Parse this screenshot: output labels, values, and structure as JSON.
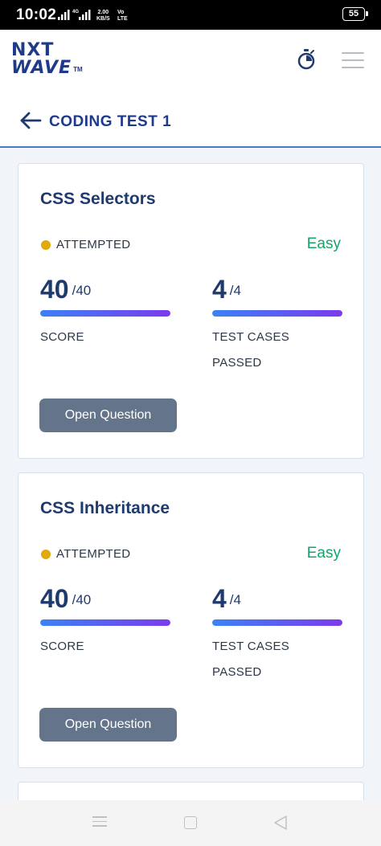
{
  "status_bar": {
    "time": "10:02",
    "network": "4G",
    "speed_value": "2.00",
    "speed_unit": "KB/S",
    "volte_top": "Vo",
    "volte_bottom": "LTE",
    "battery": "55"
  },
  "header": {
    "logo_line1": "NXT",
    "logo_line2": "WAVE",
    "logo_tm": "TM",
    "icons": [
      "stopwatch-icon",
      "hamburger-menu-icon"
    ]
  },
  "subheader": {
    "back_icon": "arrow-left-icon",
    "title": "CODING TEST 1"
  },
  "questions": [
    {
      "title": "CSS Selectors",
      "status": "ATTEMPTED",
      "status_color": "#e0a90c",
      "difficulty": "Easy",
      "difficulty_color": "#16a36b",
      "score": {
        "value": "40",
        "total": "/40",
        "label": "SCORE",
        "progress": 1.0
      },
      "test_cases": {
        "value": "4",
        "total": "/4",
        "label_line1": "TEST CASES",
        "label_line2": "PASSED",
        "progress": 1.0
      },
      "button": "Open Question"
    },
    {
      "title": "CSS Inheritance",
      "status": "ATTEMPTED",
      "status_color": "#e0a90c",
      "difficulty": "Easy",
      "difficulty_color": "#16a36b",
      "score": {
        "value": "40",
        "total": "/40",
        "label": "SCORE",
        "progress": 1.0
      },
      "test_cases": {
        "value": "4",
        "total": "/4",
        "label_line1": "TEST CASES",
        "label_line2": "PASSED",
        "progress": 1.0
      },
      "button": "Open Question"
    }
  ],
  "colors": {
    "brand": "#1e3a8a",
    "button": "#64748b",
    "progress_start": "#3b82f6",
    "progress_end": "#7c3aed"
  },
  "nav_bar": [
    "recent-apps-icon",
    "home-icon",
    "back-icon"
  ]
}
